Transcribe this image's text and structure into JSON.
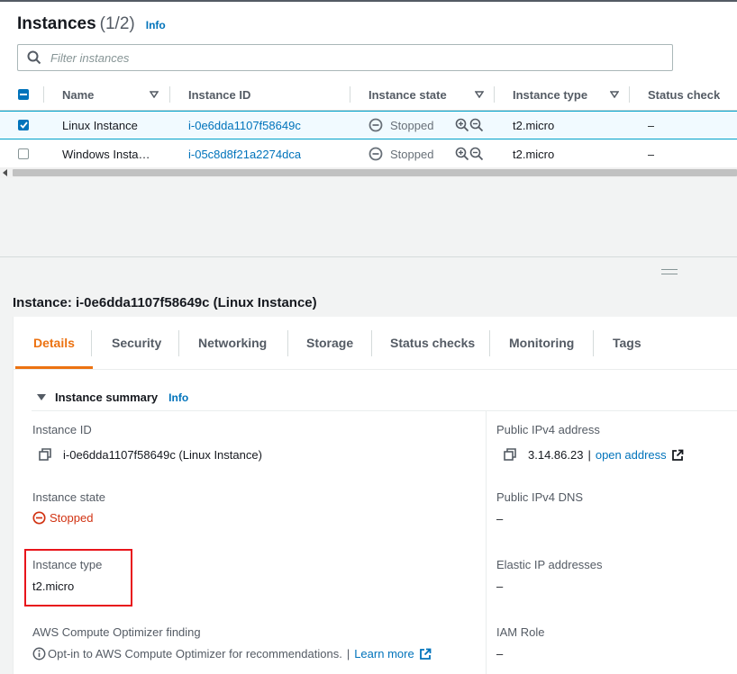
{
  "instances_panel": {
    "title": "Instances",
    "count": "(1/2)",
    "info": "Info",
    "search_placeholder": "Filter instances"
  },
  "table": {
    "columns": [
      "Name",
      "Instance ID",
      "Instance state",
      "Instance type",
      "Status check"
    ],
    "rows": [
      {
        "name": "Linux Instance",
        "instance_id": "i-0e6dda1107f58649c",
        "state": "Stopped",
        "type": "t2.micro",
        "status": "–",
        "selected": true
      },
      {
        "name": "Windows Insta…",
        "instance_id": "i-05c8d8f21a2274dca",
        "state": "Stopped",
        "type": "t2.micro",
        "status": "–",
        "selected": false
      }
    ]
  },
  "details": {
    "title": "Instance: i-0e6dda1107f58649c (Linux Instance)",
    "tabs": [
      "Details",
      "Security",
      "Networking",
      "Storage",
      "Status checks",
      "Monitoring",
      "Tags"
    ],
    "active_tab": "Details",
    "summary_title": "Instance summary",
    "summary_info": "Info",
    "left": {
      "instance_id_label": "Instance ID",
      "instance_id_value": "i-0e6dda1107f58649c (Linux Instance)",
      "state_label": "Instance state",
      "state_value": "Stopped",
      "type_label": "Instance type",
      "type_value": "t2.micro",
      "optimizer_label": "AWS Compute Optimizer finding",
      "optimizer_text": "Opt-in to AWS Compute Optimizer for recommendations.",
      "optimizer_sep": "|",
      "optimizer_link": "Learn more"
    },
    "right": {
      "ipv4_label": "Public IPv4 address",
      "ipv4_value": "3.14.86.23",
      "ipv4_sep": "|",
      "ipv4_link": "open address",
      "dns_label": "Public IPv4 DNS",
      "dns_value": "–",
      "eip_label": "Elastic IP addresses",
      "eip_value": "–",
      "iam_label": "IAM Role",
      "iam_value": "–"
    }
  },
  "colors": {
    "link": "#0073bb",
    "active_tab": "#ec7211",
    "stopped_red": "#d13212",
    "highlight": "#e8141b",
    "selected_row": "#f1faff"
  }
}
